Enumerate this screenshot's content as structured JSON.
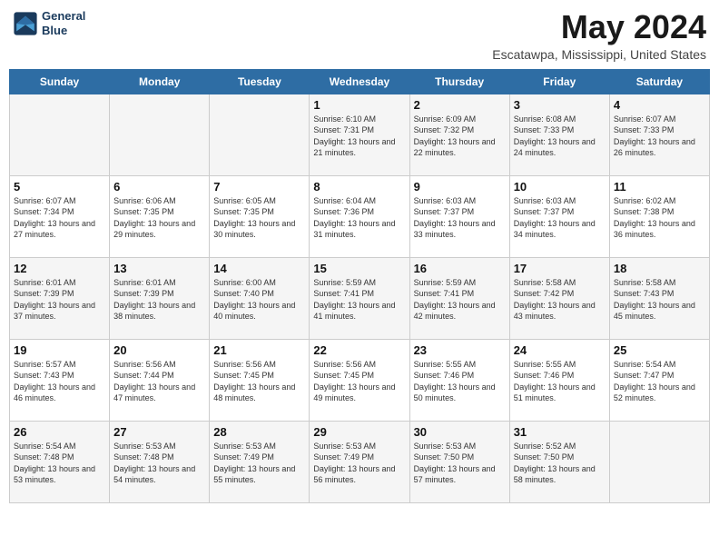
{
  "header": {
    "logo_line1": "General",
    "logo_line2": "Blue",
    "title": "May 2024",
    "subtitle": "Escatawpa, Mississippi, United States"
  },
  "days_of_week": [
    "Sunday",
    "Monday",
    "Tuesday",
    "Wednesday",
    "Thursday",
    "Friday",
    "Saturday"
  ],
  "weeks": [
    [
      {
        "num": "",
        "sunrise": "",
        "sunset": "",
        "daylight": ""
      },
      {
        "num": "",
        "sunrise": "",
        "sunset": "",
        "daylight": ""
      },
      {
        "num": "",
        "sunrise": "",
        "sunset": "",
        "daylight": ""
      },
      {
        "num": "1",
        "sunrise": "Sunrise: 6:10 AM",
        "sunset": "Sunset: 7:31 PM",
        "daylight": "Daylight: 13 hours and 21 minutes."
      },
      {
        "num": "2",
        "sunrise": "Sunrise: 6:09 AM",
        "sunset": "Sunset: 7:32 PM",
        "daylight": "Daylight: 13 hours and 22 minutes."
      },
      {
        "num": "3",
        "sunrise": "Sunrise: 6:08 AM",
        "sunset": "Sunset: 7:33 PM",
        "daylight": "Daylight: 13 hours and 24 minutes."
      },
      {
        "num": "4",
        "sunrise": "Sunrise: 6:07 AM",
        "sunset": "Sunset: 7:33 PM",
        "daylight": "Daylight: 13 hours and 26 minutes."
      }
    ],
    [
      {
        "num": "5",
        "sunrise": "Sunrise: 6:07 AM",
        "sunset": "Sunset: 7:34 PM",
        "daylight": "Daylight: 13 hours and 27 minutes."
      },
      {
        "num": "6",
        "sunrise": "Sunrise: 6:06 AM",
        "sunset": "Sunset: 7:35 PM",
        "daylight": "Daylight: 13 hours and 29 minutes."
      },
      {
        "num": "7",
        "sunrise": "Sunrise: 6:05 AM",
        "sunset": "Sunset: 7:35 PM",
        "daylight": "Daylight: 13 hours and 30 minutes."
      },
      {
        "num": "8",
        "sunrise": "Sunrise: 6:04 AM",
        "sunset": "Sunset: 7:36 PM",
        "daylight": "Daylight: 13 hours and 31 minutes."
      },
      {
        "num": "9",
        "sunrise": "Sunrise: 6:03 AM",
        "sunset": "Sunset: 7:37 PM",
        "daylight": "Daylight: 13 hours and 33 minutes."
      },
      {
        "num": "10",
        "sunrise": "Sunrise: 6:03 AM",
        "sunset": "Sunset: 7:37 PM",
        "daylight": "Daylight: 13 hours and 34 minutes."
      },
      {
        "num": "11",
        "sunrise": "Sunrise: 6:02 AM",
        "sunset": "Sunset: 7:38 PM",
        "daylight": "Daylight: 13 hours and 36 minutes."
      }
    ],
    [
      {
        "num": "12",
        "sunrise": "Sunrise: 6:01 AM",
        "sunset": "Sunset: 7:39 PM",
        "daylight": "Daylight: 13 hours and 37 minutes."
      },
      {
        "num": "13",
        "sunrise": "Sunrise: 6:01 AM",
        "sunset": "Sunset: 7:39 PM",
        "daylight": "Daylight: 13 hours and 38 minutes."
      },
      {
        "num": "14",
        "sunrise": "Sunrise: 6:00 AM",
        "sunset": "Sunset: 7:40 PM",
        "daylight": "Daylight: 13 hours and 40 minutes."
      },
      {
        "num": "15",
        "sunrise": "Sunrise: 5:59 AM",
        "sunset": "Sunset: 7:41 PM",
        "daylight": "Daylight: 13 hours and 41 minutes."
      },
      {
        "num": "16",
        "sunrise": "Sunrise: 5:59 AM",
        "sunset": "Sunset: 7:41 PM",
        "daylight": "Daylight: 13 hours and 42 minutes."
      },
      {
        "num": "17",
        "sunrise": "Sunrise: 5:58 AM",
        "sunset": "Sunset: 7:42 PM",
        "daylight": "Daylight: 13 hours and 43 minutes."
      },
      {
        "num": "18",
        "sunrise": "Sunrise: 5:58 AM",
        "sunset": "Sunset: 7:43 PM",
        "daylight": "Daylight: 13 hours and 45 minutes."
      }
    ],
    [
      {
        "num": "19",
        "sunrise": "Sunrise: 5:57 AM",
        "sunset": "Sunset: 7:43 PM",
        "daylight": "Daylight: 13 hours and 46 minutes."
      },
      {
        "num": "20",
        "sunrise": "Sunrise: 5:56 AM",
        "sunset": "Sunset: 7:44 PM",
        "daylight": "Daylight: 13 hours and 47 minutes."
      },
      {
        "num": "21",
        "sunrise": "Sunrise: 5:56 AM",
        "sunset": "Sunset: 7:45 PM",
        "daylight": "Daylight: 13 hours and 48 minutes."
      },
      {
        "num": "22",
        "sunrise": "Sunrise: 5:56 AM",
        "sunset": "Sunset: 7:45 PM",
        "daylight": "Daylight: 13 hours and 49 minutes."
      },
      {
        "num": "23",
        "sunrise": "Sunrise: 5:55 AM",
        "sunset": "Sunset: 7:46 PM",
        "daylight": "Daylight: 13 hours and 50 minutes."
      },
      {
        "num": "24",
        "sunrise": "Sunrise: 5:55 AM",
        "sunset": "Sunset: 7:46 PM",
        "daylight": "Daylight: 13 hours and 51 minutes."
      },
      {
        "num": "25",
        "sunrise": "Sunrise: 5:54 AM",
        "sunset": "Sunset: 7:47 PM",
        "daylight": "Daylight: 13 hours and 52 minutes."
      }
    ],
    [
      {
        "num": "26",
        "sunrise": "Sunrise: 5:54 AM",
        "sunset": "Sunset: 7:48 PM",
        "daylight": "Daylight: 13 hours and 53 minutes."
      },
      {
        "num": "27",
        "sunrise": "Sunrise: 5:53 AM",
        "sunset": "Sunset: 7:48 PM",
        "daylight": "Daylight: 13 hours and 54 minutes."
      },
      {
        "num": "28",
        "sunrise": "Sunrise: 5:53 AM",
        "sunset": "Sunset: 7:49 PM",
        "daylight": "Daylight: 13 hours and 55 minutes."
      },
      {
        "num": "29",
        "sunrise": "Sunrise: 5:53 AM",
        "sunset": "Sunset: 7:49 PM",
        "daylight": "Daylight: 13 hours and 56 minutes."
      },
      {
        "num": "30",
        "sunrise": "Sunrise: 5:53 AM",
        "sunset": "Sunset: 7:50 PM",
        "daylight": "Daylight: 13 hours and 57 minutes."
      },
      {
        "num": "31",
        "sunrise": "Sunrise: 5:52 AM",
        "sunset": "Sunset: 7:50 PM",
        "daylight": "Daylight: 13 hours and 58 minutes."
      },
      {
        "num": "",
        "sunrise": "",
        "sunset": "",
        "daylight": ""
      }
    ]
  ]
}
